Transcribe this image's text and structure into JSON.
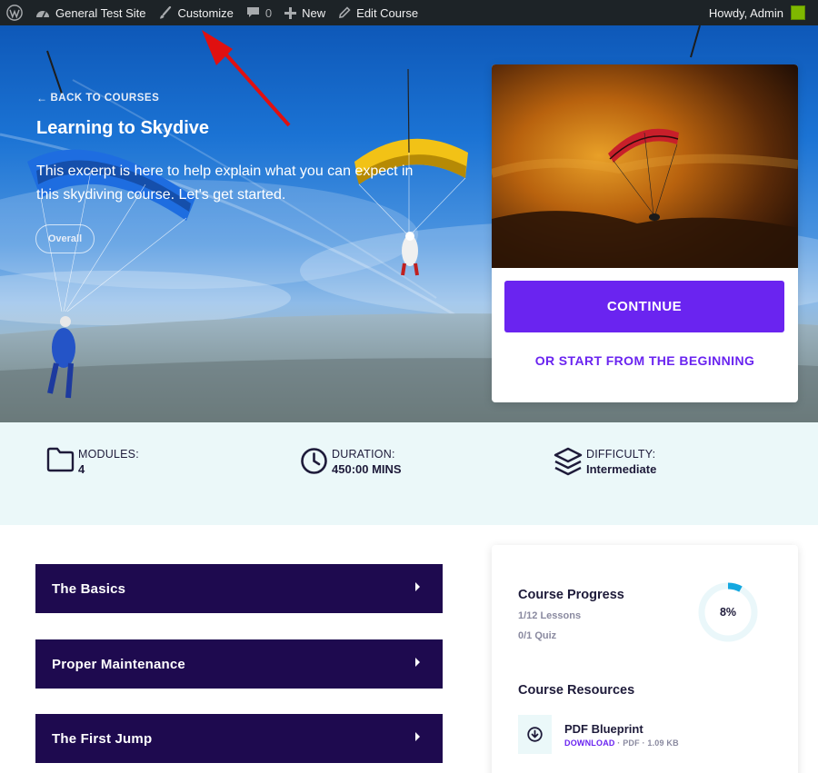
{
  "adminbar": {
    "site_name": "General Test Site",
    "customize": "Customize",
    "comments_count": "0",
    "new": "New",
    "edit_course": "Edit Course",
    "howdy": "Howdy, Admin"
  },
  "hero": {
    "back_link": "BACK TO COURSES",
    "title": "Learning to Skydive",
    "excerpt": "This excerpt is here to help explain what you can expect in this skydiving course. Let's get started.",
    "tag": "Overall"
  },
  "cta": {
    "continue_label": "CONTINUE",
    "restart_label": "OR START FROM THE BEGINNING"
  },
  "stats": {
    "modules": {
      "label": "MODULES:",
      "value": "4"
    },
    "duration": {
      "label": "DURATION:",
      "value": "450:00 MINS"
    },
    "difficulty": {
      "label": "DIFFICULTY:",
      "value": "Intermediate"
    }
  },
  "modules": [
    {
      "title": "The Basics"
    },
    {
      "title": "Proper Maintenance"
    },
    {
      "title": "The First Jump"
    }
  ],
  "progress": {
    "title": "Course Progress",
    "lessons": "1/12 Lessons",
    "quiz": "0/1 Quiz",
    "percent_label": "8%",
    "percent": 8,
    "resources_title": "Course Resources",
    "resource": {
      "name": "PDF Blueprint",
      "download": "DOWNLOAD",
      "meta": " · PDF · 1.09 KB"
    }
  },
  "colors": {
    "accent": "#6a24f0",
    "module_bg": "#1e0a4f",
    "stats_bg": "#ebf8f9",
    "progress_ring": "#14a8e0",
    "adminbar_bg": "#1d2327"
  }
}
